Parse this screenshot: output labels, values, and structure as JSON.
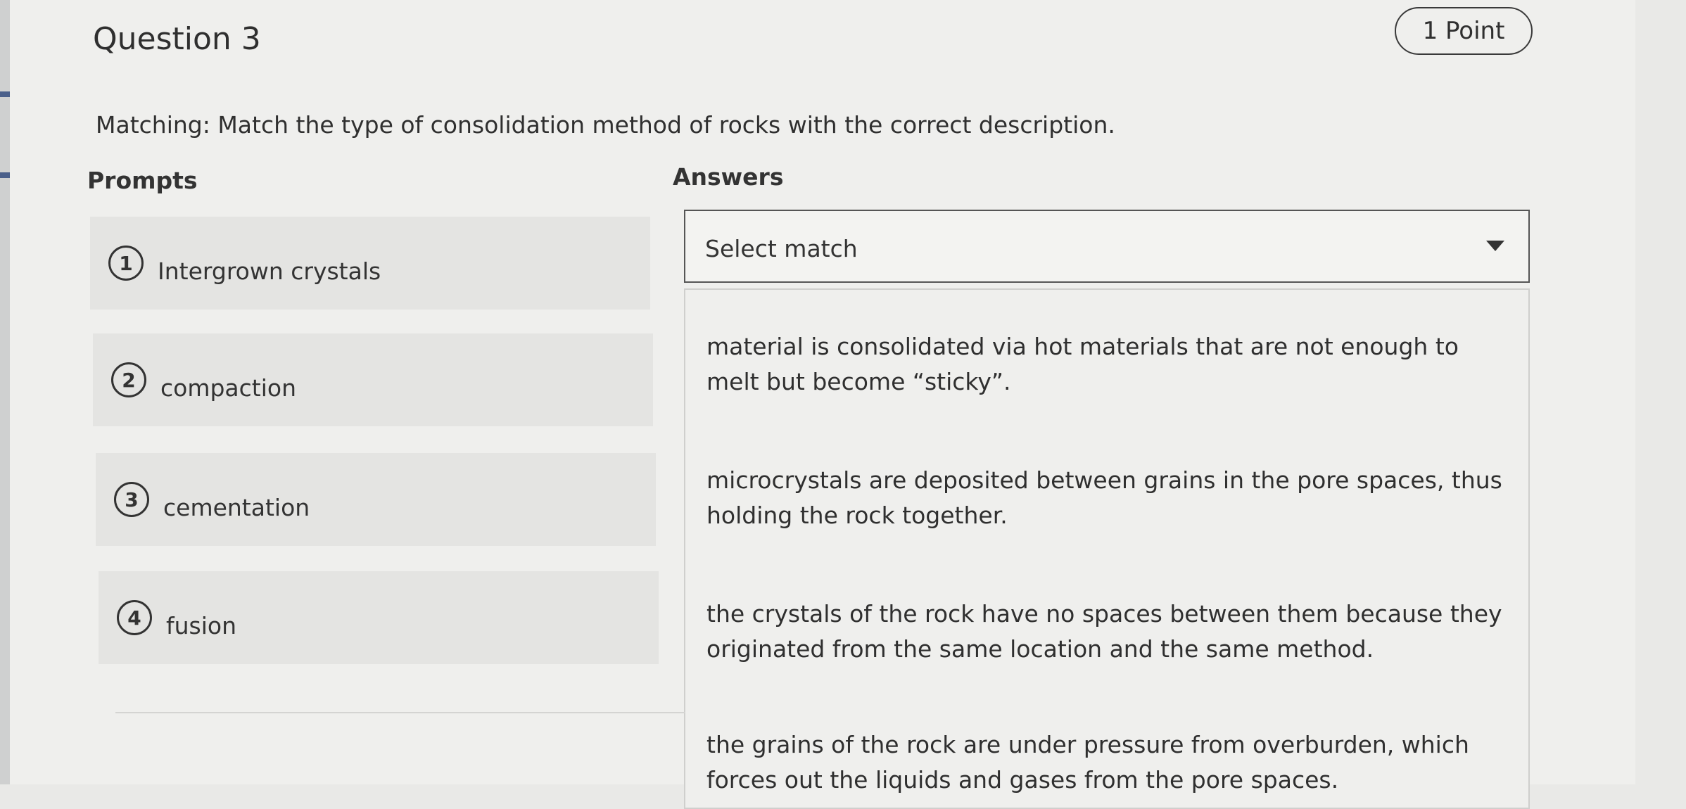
{
  "question": {
    "title": "Question 3",
    "points": "1 Point",
    "instructions": "Matching: Match the type of consolidation method of rocks with the correct description."
  },
  "columns": {
    "prompts": "Prompts",
    "answers": "Answers"
  },
  "prompts": [
    {
      "number": "1",
      "text": "Intergrown crystals"
    },
    {
      "number": "2",
      "text": "compaction"
    },
    {
      "number": "3",
      "text": "cementation"
    },
    {
      "number": "4",
      "text": "fusion"
    }
  ],
  "select": {
    "value": "Select match",
    "icon": "triangle-down-icon"
  },
  "answers": [
    "material is consolidated via hot materials that are not enough to melt but become “sticky”.",
    "microcrystals are deposited between grains in the pore spaces, thus holding the rock together.",
    "the crystals of the rock have no spaces between them because they originated from the same location and the same method.",
    "the grains of the rock are under pressure from overburden, which forces out the liquids and gases from the pore spaces."
  ]
}
